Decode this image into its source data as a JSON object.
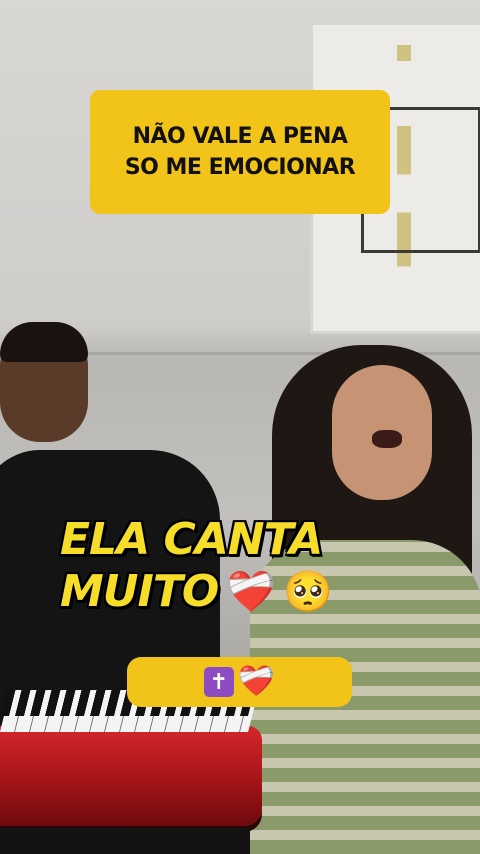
{
  "captions": {
    "top": "NÃO VALE A PENA\nSO ME EMOCIONAR",
    "main_line1": "ELA CANTA",
    "main_line2": "MUITO",
    "main_emojis": [
      "❤️‍🩹",
      "🥺"
    ],
    "bottom_emojis": [
      "✝",
      "❤️‍🩹"
    ]
  },
  "colors": {
    "caption_bg": "#f2c319",
    "main_text": "#f5dd2a",
    "cross_bg": "#8e4cc3"
  },
  "icons": [
    "mending-heart-icon",
    "pleading-face-icon",
    "latin-cross-icon"
  ]
}
